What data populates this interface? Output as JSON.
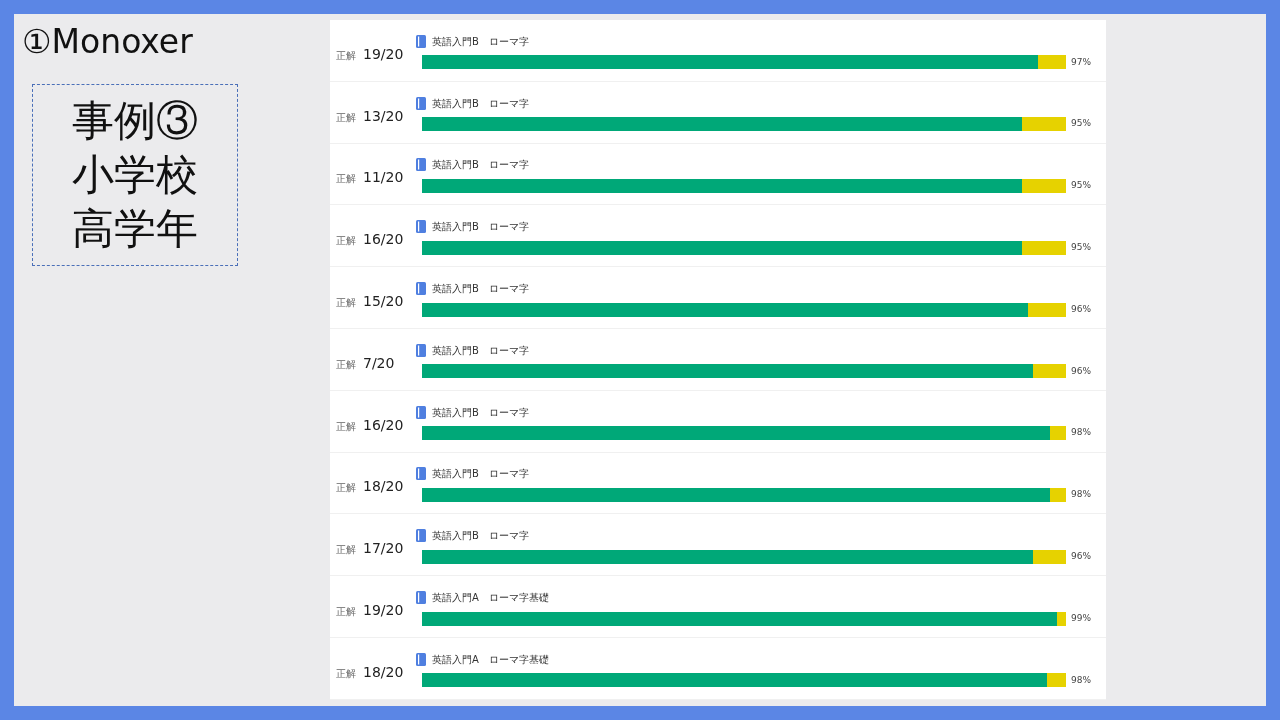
{
  "slide": {
    "title": "①Monoxer",
    "case_lines": [
      "事例③",
      "小学校",
      "高学年"
    ]
  },
  "results": [
    {
      "label": "正解",
      "score": "19/20",
      "course": "英語入門B",
      "unit": "ローマ字",
      "level": 0.957,
      "percent": "97%"
    },
    {
      "label": "正解",
      "score": "13/20",
      "course": "英語入門B",
      "unit": "ローマ字",
      "level": 0.932,
      "percent": "95%"
    },
    {
      "label": "正解",
      "score": "11/20",
      "course": "英語入門B",
      "unit": "ローマ字",
      "level": 0.932,
      "percent": "95%"
    },
    {
      "label": "正解",
      "score": "16/20",
      "course": "英語入門B",
      "unit": "ローマ字",
      "level": 0.932,
      "percent": "95%"
    },
    {
      "label": "正解",
      "score": "15/20",
      "course": "英語入門B",
      "unit": "ローマ字",
      "level": 0.941,
      "percent": "96%"
    },
    {
      "label": "正解",
      "score": "7/20",
      "course": "英語入門B",
      "unit": "ローマ字",
      "level": 0.949,
      "percent": "96%"
    },
    {
      "label": "正解",
      "score": "16/20",
      "course": "英語入門B",
      "unit": "ローマ字",
      "level": 0.975,
      "percent": "98%"
    },
    {
      "label": "正解",
      "score": "18/20",
      "course": "英語入門B",
      "unit": "ローマ字",
      "level": 0.975,
      "percent": "98%"
    },
    {
      "label": "正解",
      "score": "17/20",
      "course": "英語入門B",
      "unit": "ローマ字",
      "level": 0.949,
      "percent": "96%"
    },
    {
      "label": "正解",
      "score": "19/20",
      "course": "英語入門A",
      "unit": "ローマ字基礎",
      "level": 0.986,
      "percent": "99%"
    },
    {
      "label": "正解",
      "score": "18/20",
      "course": "英語入門A",
      "unit": "ローマ字基礎",
      "level": 0.97,
      "percent": "98%"
    }
  ]
}
